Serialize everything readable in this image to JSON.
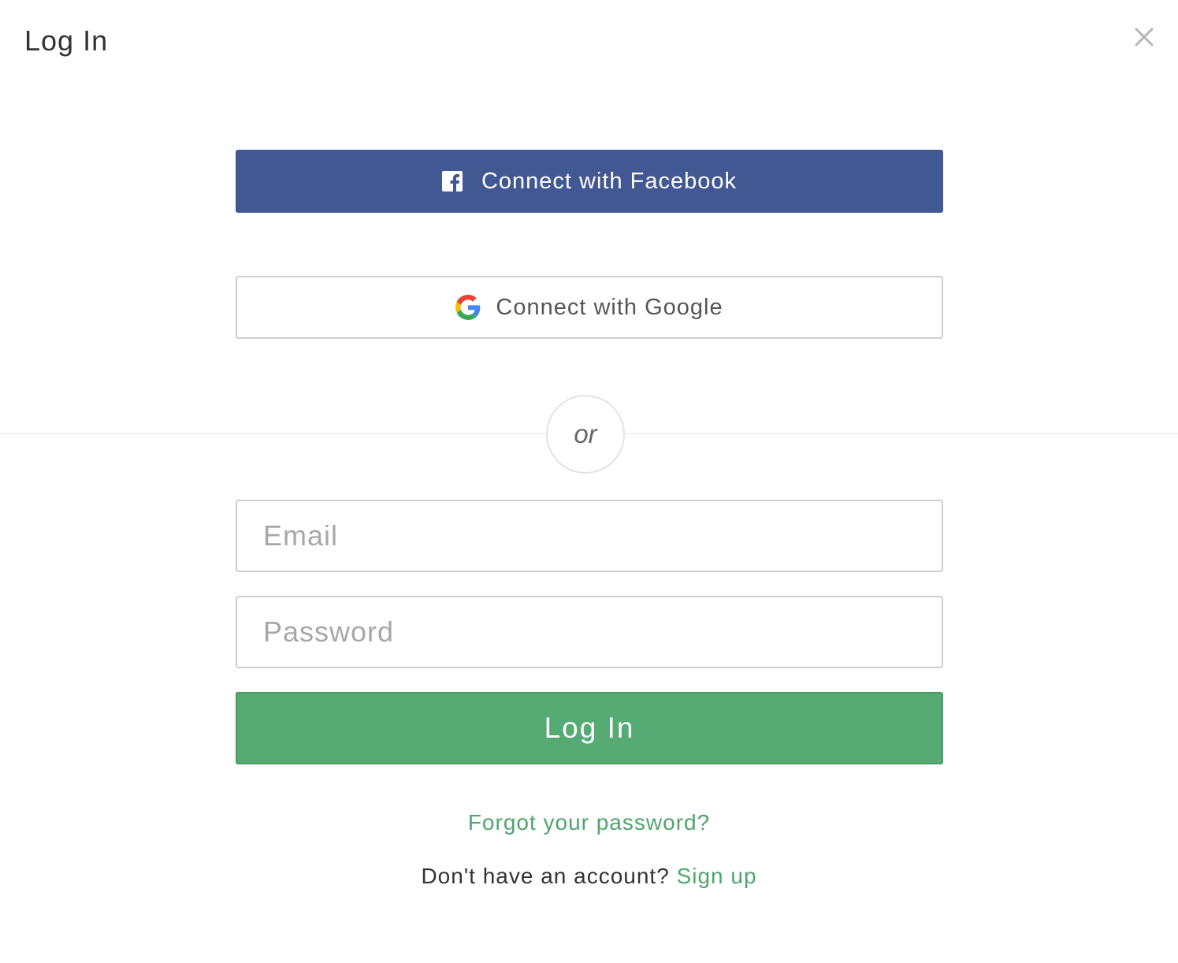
{
  "dialog": {
    "title": "Log In",
    "close_icon": "close-icon"
  },
  "social": {
    "facebook_label": "Connect with Facebook",
    "facebook_icon": "facebook-icon",
    "facebook_color": "#425893",
    "google_label": "Connect with Google",
    "google_icon": "google-icon"
  },
  "divider": {
    "label": "or"
  },
  "form": {
    "email_placeholder": "Email",
    "email_value": "",
    "password_placeholder": "Password",
    "password_value": "",
    "submit_label": "Log In",
    "submit_color": "#56aa73"
  },
  "footer": {
    "forgot_label": "Forgot your password?",
    "no_account_text": "Don't have an account?",
    "signup_label": "Sign up",
    "link_color": "#4ea56e"
  }
}
